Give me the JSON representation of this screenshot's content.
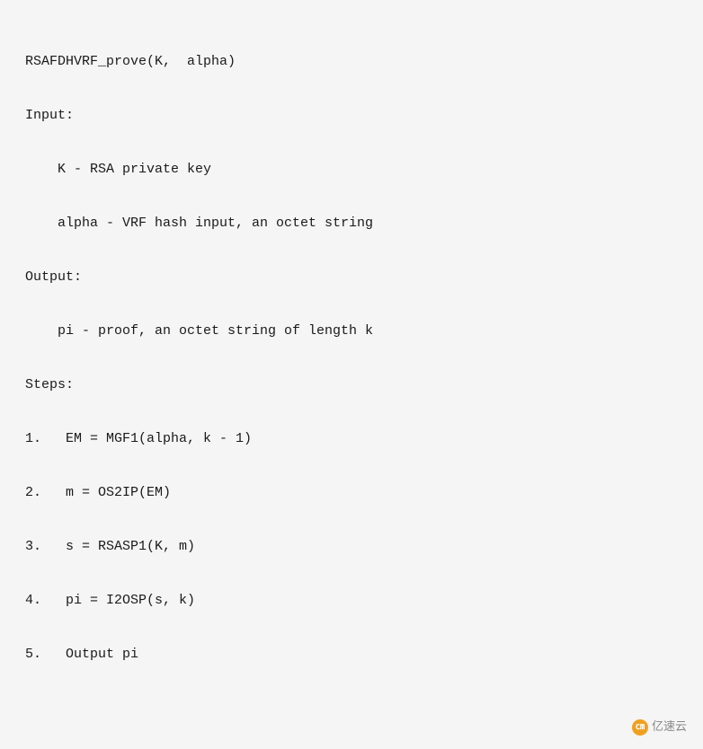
{
  "content": {
    "function_signature": "RSAFDHVRF_prove(K,  alpha)",
    "input_label": "Input:",
    "input_k": "    K - RSA private key",
    "input_alpha": "    alpha - VRF hash input, an octet string",
    "output_label": "Output:",
    "output_pi": "    pi - proof, an octet string of length k",
    "steps_label": "Steps:",
    "step1": "1.   EM = MGF1(alpha, k - 1)",
    "step2": "2.   m = OS2IP(EM)",
    "step3": "3.   s = RSASP1(K, m)",
    "step4": "4.   pi = I2OSP(s, k)",
    "step5": "5.   Output pi",
    "watermark": "亿速云"
  }
}
